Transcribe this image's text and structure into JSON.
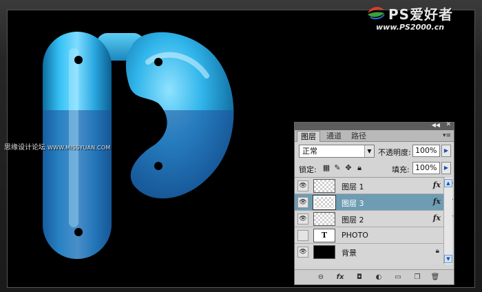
{
  "watermark_top": {
    "title": "PS爱好者",
    "url": "www.PS2000.cn"
  },
  "watermark_left": {
    "text": "思缘设计论坛",
    "url": "WWW.MISSYUAN.COM"
  },
  "panel": {
    "tabs": [
      {
        "label": "图层",
        "active": true
      },
      {
        "label": "通道",
        "active": false
      },
      {
        "label": "路径",
        "active": false
      }
    ],
    "blend_mode": "正常",
    "opacity_label": "不透明度:",
    "opacity_value": "100%",
    "lock_label": "锁定:",
    "fill_label": "填充:",
    "fill_value": "100%",
    "layers": [
      {
        "name": "图层 1",
        "visible": true,
        "selected": false,
        "fx": "fx",
        "thumb": "transparent"
      },
      {
        "name": "图层 3",
        "visible": true,
        "selected": true,
        "fx": "fx",
        "thumb": "transparent"
      },
      {
        "name": "图层 2",
        "visible": true,
        "selected": false,
        "fx": "fx",
        "thumb": "transparent"
      },
      {
        "name": "PHOTO",
        "visible": false,
        "selected": false,
        "fx": "",
        "thumb": "T"
      },
      {
        "name": "背景",
        "visible": true,
        "selected": false,
        "fx": "",
        "thumb": "black",
        "locked": true
      }
    ],
    "footer_icons": [
      "link-icon",
      "fx-icon",
      "mask-icon",
      "adjustment-icon",
      "group-icon",
      "new-layer-icon",
      "trash-icon"
    ]
  },
  "colors": {
    "panel_bg": "#d4d4d4",
    "selected_row": "#6e9cb3",
    "art_blue": "#2aa7e0",
    "art_overlay": "#2f6fb8"
  }
}
